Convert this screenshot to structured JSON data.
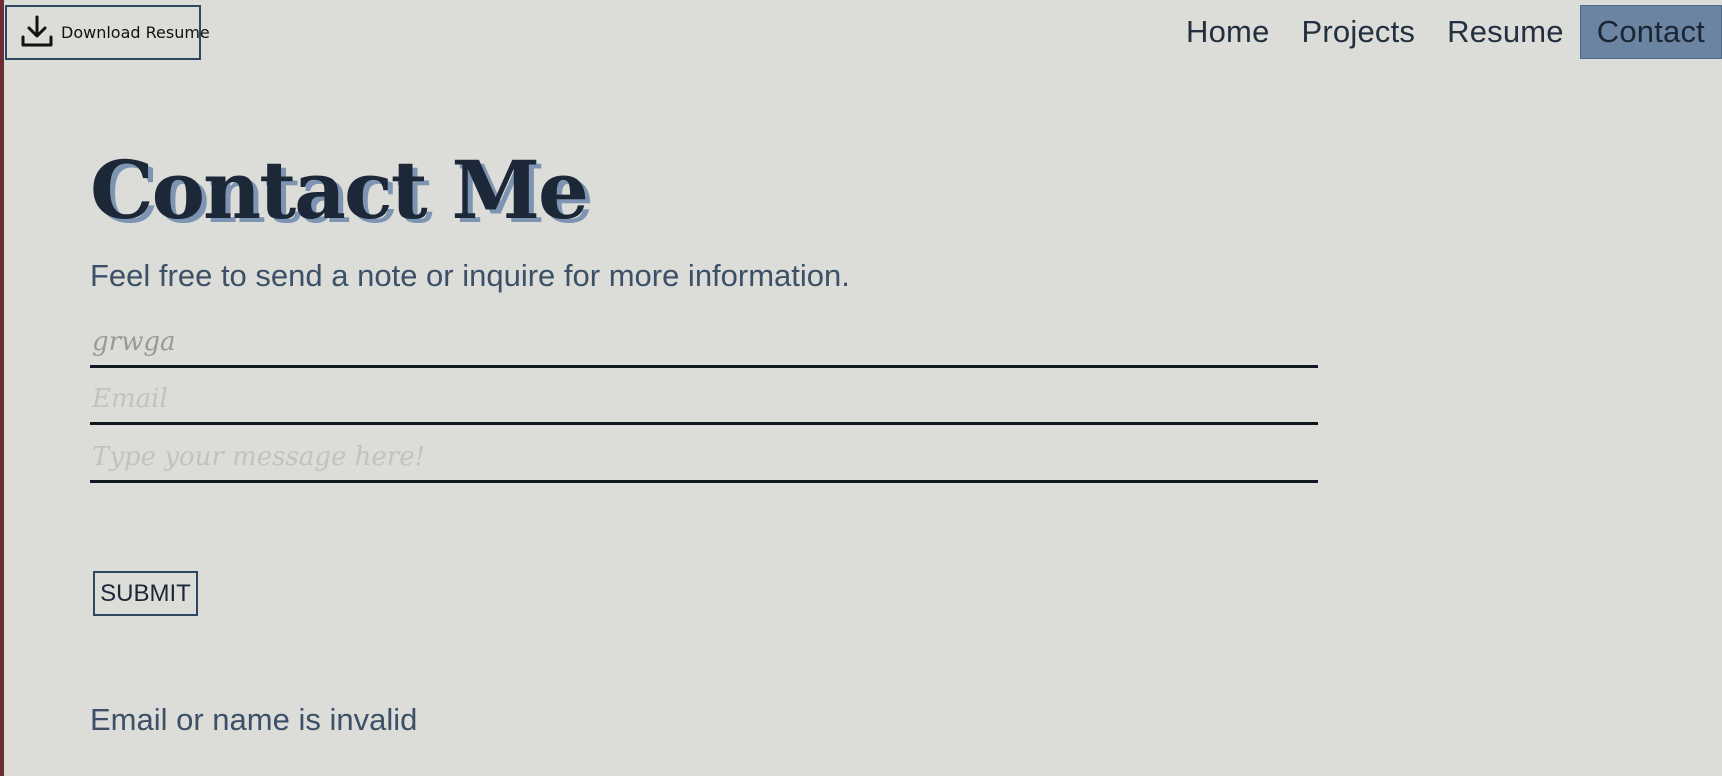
{
  "header": {
    "download_button": {
      "label": "Download Resume",
      "icon": "download-icon"
    },
    "nav": {
      "items": [
        {
          "label": "Home"
        },
        {
          "label": "Projects"
        },
        {
          "label": "Resume"
        },
        {
          "label": "Contact",
          "active": true
        }
      ]
    }
  },
  "main": {
    "title": "Contact Me",
    "subtitle": "Feel free to send a note or inquire for more information.",
    "form": {
      "name_value": "grwga",
      "name_placeholder": "",
      "email_placeholder": "Email",
      "message_placeholder": "Type your message here!",
      "submit_label": "SUBMIT"
    },
    "error_message": "Email or name is invalid"
  },
  "colors": {
    "background": "#dcdcd8",
    "accent": "#6b84a2",
    "text_dark": "#1c2838",
    "text_muted": "#3c5068"
  }
}
